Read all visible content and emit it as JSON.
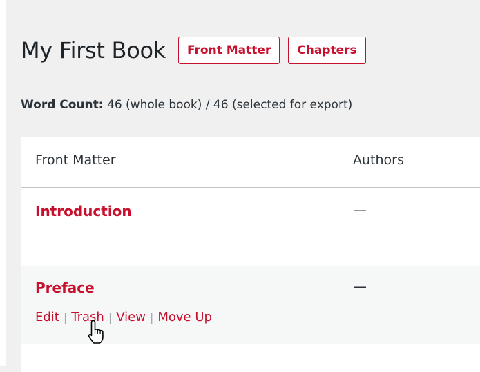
{
  "header": {
    "title": "My First Book",
    "buttons": [
      {
        "label": "Front Matter"
      },
      {
        "label": "Chapters"
      }
    ]
  },
  "word_count": {
    "label": "Word Count:",
    "value": " 46 (whole book) / 46 (selected for export)"
  },
  "table": {
    "columns": [
      "Front Matter",
      "Authors"
    ],
    "rows": [
      {
        "title": "Introduction",
        "author": "—"
      },
      {
        "title": "Preface",
        "author": "—",
        "actions": [
          "Edit",
          "Trash",
          "View",
          "Move Up"
        ],
        "separator": "|"
      }
    ]
  },
  "colors": {
    "accent": "#c8102e",
    "page_background": "#f0f0f1",
    "alt_row": "#f6f7f7",
    "border": "#c3c4c7"
  },
  "cursor": {
    "icon": "hand-pointer-icon"
  }
}
